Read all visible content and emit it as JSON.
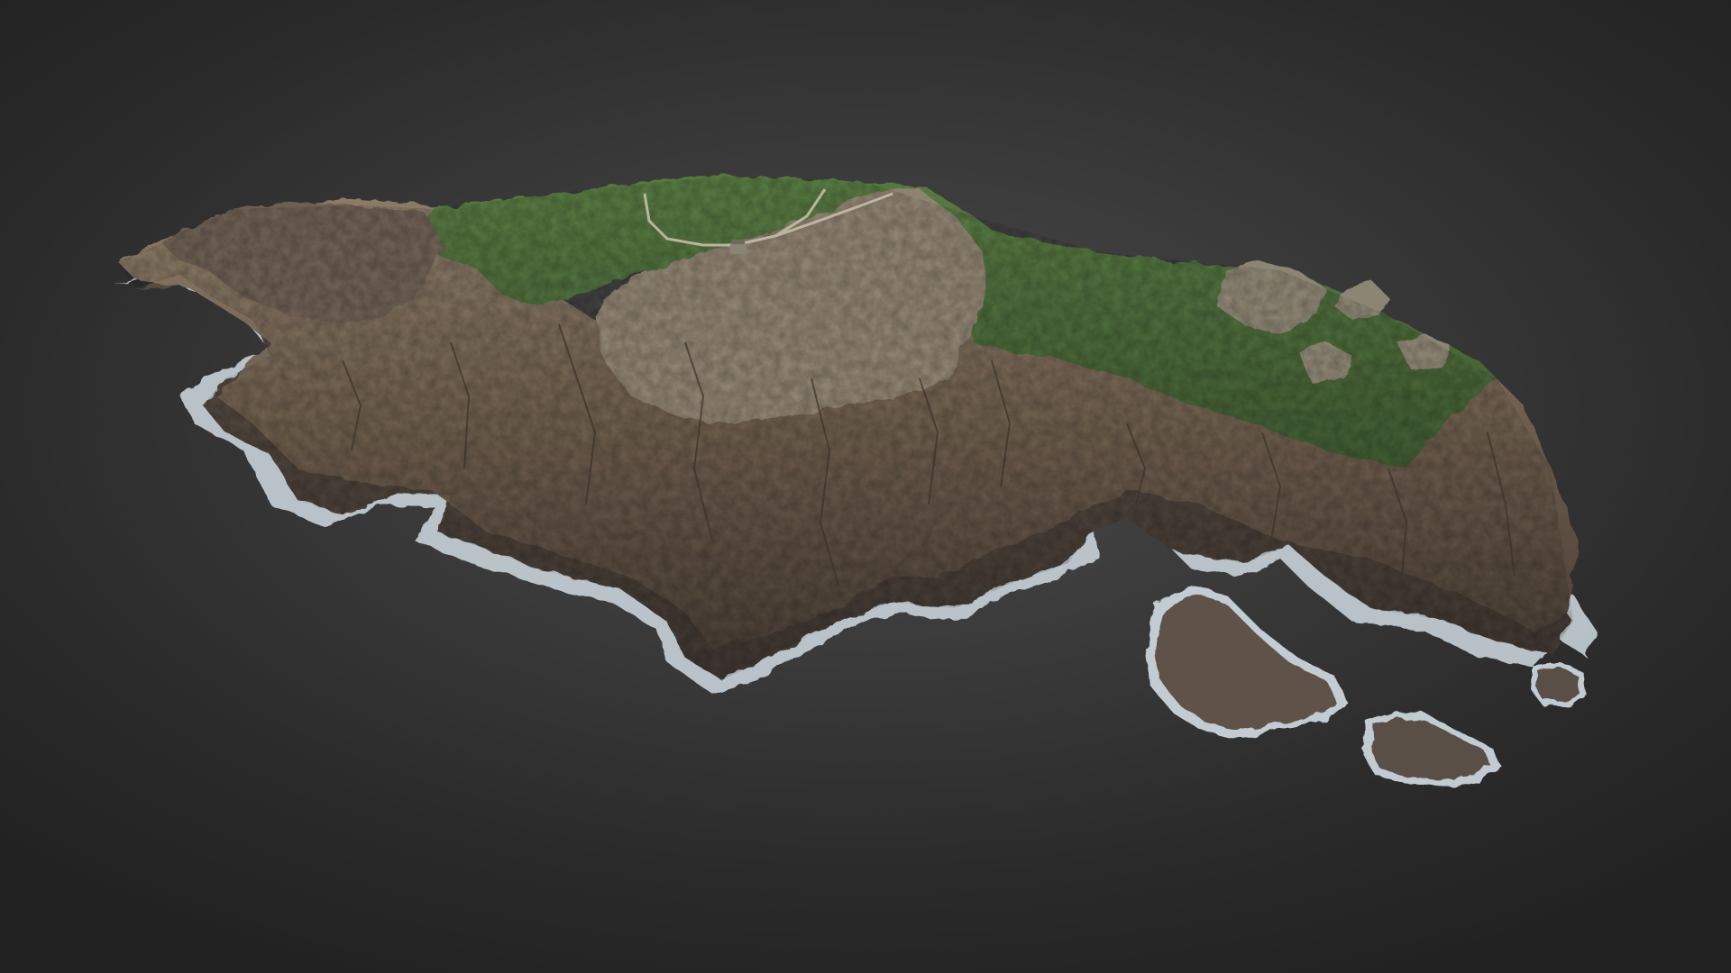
{
  "scene": {
    "subject": "photogrammetry-3d-model",
    "colors": {
      "background": "#2b2b2b",
      "grass": "#4e6a3a",
      "grass_dark": "#3d5530",
      "rock": "#7a6a58",
      "rock_dark": "#4d4238",
      "rock_light": "#a39682",
      "surf": "#d9e4ea",
      "path": "#bfb8a6"
    }
  }
}
